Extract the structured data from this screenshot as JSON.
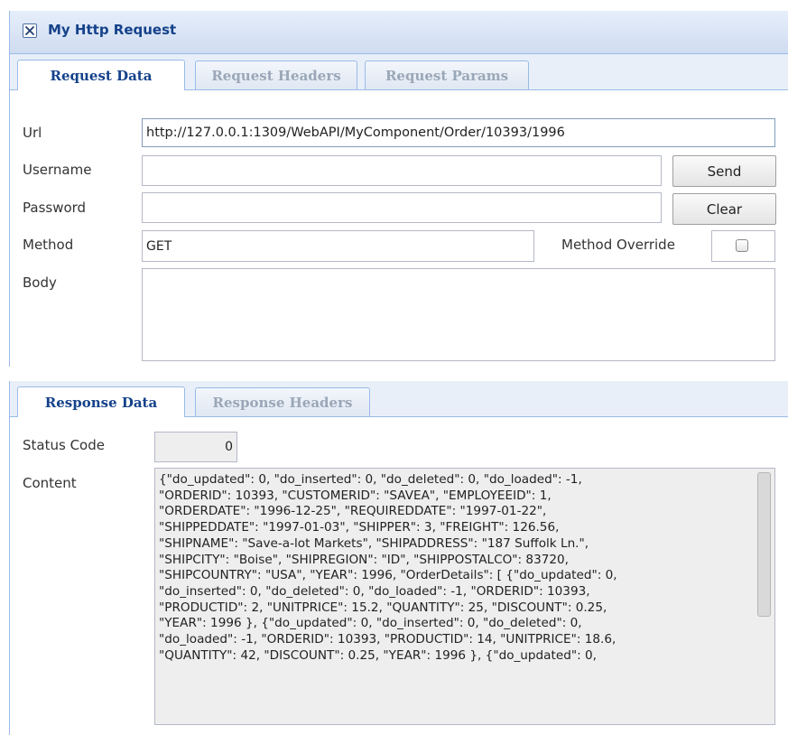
{
  "window": {
    "title": "My Http Request"
  },
  "request_tabs": [
    {
      "label": "Request Data",
      "active": true
    },
    {
      "label": "Request Headers",
      "active": false
    },
    {
      "label": "Request Params",
      "active": false
    }
  ],
  "form": {
    "url_label": "Url",
    "url_value": "http://127.0.0.1:1309/WebAPI/MyComponent/Order/10393/1996",
    "username_label": "Username",
    "username_value": "",
    "password_label": "Password",
    "password_value": "",
    "method_label": "Method",
    "method_value": "GET",
    "method_override_label": "Method Override",
    "method_override_checked": false,
    "body_label": "Body",
    "body_value": ""
  },
  "buttons": {
    "send_label": "Send",
    "clear_label": "Clear"
  },
  "response_tabs": [
    {
      "label": "Response Data",
      "active": true
    },
    {
      "label": "Response Headers",
      "active": false
    }
  ],
  "response": {
    "status_code_label": "Status Code",
    "status_code_value": "0",
    "content_label": "Content",
    "content_lines": [
      "{\"do_updated\": 0, \"do_inserted\": 0, \"do_deleted\": 0, \"do_loaded\": -1,",
      "\"ORDERID\": 10393, \"CUSTOMERID\": \"SAVEA\", \"EMPLOYEEID\": 1,",
      "\"ORDERDATE\": \"1996-12-25\", \"REQUIREDDATE\": \"1997-01-22\",",
      "\"SHIPPEDDATE\": \"1997-01-03\", \"SHIPPER\": 3, \"FREIGHT\": 126.56,",
      "\"SHIPNAME\": \"Save-a-lot Markets\", \"SHIPADDRESS\": \"187 Suffolk Ln.\",",
      "\"SHIPCITY\": \"Boise\", \"SHIPREGION\": \"ID\", \"SHIPPOSTALCO\": 83720,",
      "\"SHIPCOUNTRY\": \"USA\", \"YEAR\": 1996, \"OrderDetails\": [ {\"do_updated\": 0,",
      "\"do_inserted\": 0, \"do_deleted\": 0, \"do_loaded\": -1, \"ORDERID\": 10393,",
      "\"PRODUCTID\": 2, \"UNITPRICE\": 15.2, \"QUANTITY\": 25, \"DISCOUNT\": 0.25,",
      "\"YEAR\": 1996 }, {\"do_updated\": 0, \"do_inserted\": 0, \"do_deleted\": 0,",
      "\"do_loaded\": -1, \"ORDERID\": 10393, \"PRODUCTID\": 14, \"UNITPRICE\": 18.6,",
      "\"QUANTITY\": 42, \"DISCOUNT\": 0.25, \"YEAR\": 1996 }, {\"do_updated\": 0,"
    ]
  },
  "icons": {
    "close": "close-icon",
    "checkbox": "checkbox-icon"
  },
  "colors": {
    "title_text": "#15428b",
    "panel_border": "#99bbe8",
    "inactive_tab_text": "#9aa7b7"
  }
}
